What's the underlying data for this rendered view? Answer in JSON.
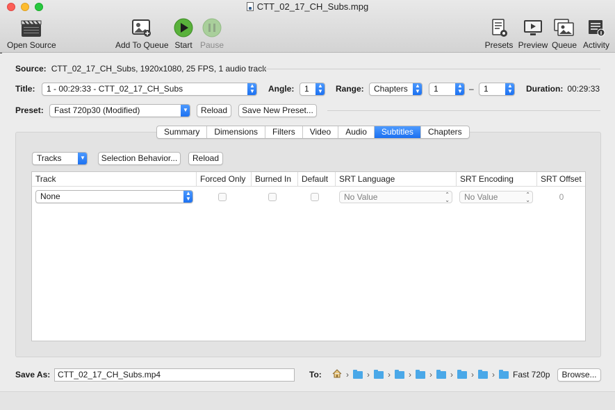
{
  "window": {
    "title": "CTT_02_17_CH_Subs.mpg"
  },
  "toolbar": {
    "open_source": "Open Source",
    "add_to_queue": "Add To Queue",
    "start": "Start",
    "pause": "Pause",
    "presets": "Presets",
    "preview": "Preview",
    "queue": "Queue",
    "activity": "Activity"
  },
  "source": {
    "label": "Source:",
    "value": "CTT_02_17_CH_Subs, 1920x1080, 25 FPS, 1 audio track"
  },
  "title_row": {
    "title_label": "Title:",
    "title_value": "1 - 00:29:33 - CTT_02_17_CH_Subs",
    "angle_label": "Angle:",
    "angle_value": "1",
    "range_label": "Range:",
    "range_value": "Chapters",
    "range_from": "1",
    "range_dash": "–",
    "range_to": "1",
    "duration_label": "Duration:",
    "duration_value": "00:29:33"
  },
  "preset_row": {
    "label": "Preset:",
    "value": "Fast 720p30 (Modified)",
    "reload": "Reload",
    "save_new": "Save New Preset..."
  },
  "tabs": [
    "Summary",
    "Dimensions",
    "Filters",
    "Video",
    "Audio",
    "Subtitles",
    "Chapters"
  ],
  "active_tab": "Subtitles",
  "subtitles": {
    "tracks_popup": "Tracks",
    "selection_behavior": "Selection Behavior...",
    "reload": "Reload",
    "columns": [
      "Track",
      "Forced Only",
      "Burned In",
      "Default",
      "SRT Language",
      "SRT Encoding",
      "SRT Offset"
    ],
    "row": {
      "track": "None",
      "srt_language": "No Value",
      "srt_encoding": "No Value",
      "srt_offset": "0"
    }
  },
  "save": {
    "label": "Save As:",
    "filename": "CTT_02_17_CH_Subs.mp4",
    "to_label": "To:",
    "dest_folder": "Fast 720p",
    "browse": "Browse..."
  },
  "colors": {
    "accent": "#1a6ff0",
    "start_green": "#3a9b2c"
  }
}
